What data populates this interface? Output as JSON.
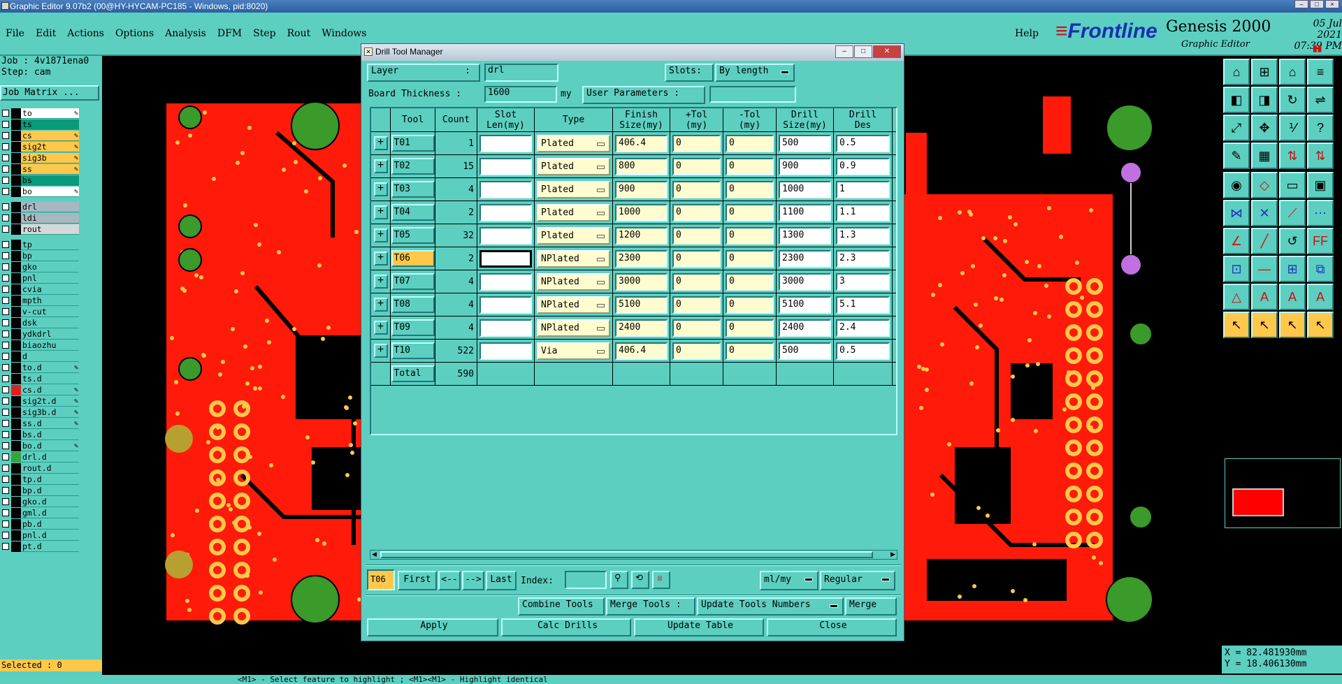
{
  "window": {
    "title": "Graphic Editor 9.07b2 (00@HY-HYCAM-PC185 - Windows, pid:8020)"
  },
  "menu": [
    "File",
    "Edit",
    "Actions",
    "Options",
    "Analysis",
    "DFM",
    "Step",
    "Rout",
    "Windows"
  ],
  "help_label": "Help",
  "brand": {
    "logo": "Frontline",
    "product": "Genesis 2000",
    "subtitle": "Graphic Editor",
    "date": "05 Jul 2021",
    "time": "07:39 PM"
  },
  "left": {
    "job": "Job : 4v1871ena0",
    "step": "Step: cam",
    "job_matrix": "Job Matrix ...",
    "layers": [
      {
        "name": "to",
        "bg": "#ffffff",
        "swatch": "#000000",
        "pen": true
      },
      {
        "name": "ts",
        "bg": "#0a9a7a",
        "swatch": "#000000",
        "pen": false
      },
      {
        "name": "cs",
        "bg": "#ffc84a",
        "swatch": "#000000",
        "pen": true
      },
      {
        "name": "sig2t",
        "bg": "#ffc84a",
        "swatch": "#000000",
        "pen": true
      },
      {
        "name": "sig3b",
        "bg": "#ffc84a",
        "swatch": "#000000",
        "pen": true
      },
      {
        "name": "ss",
        "bg": "#ffc84a",
        "swatch": "#000000",
        "pen": true
      },
      {
        "name": "bs",
        "bg": "#0a9a7a",
        "swatch": "#000000",
        "pen": false
      },
      {
        "name": "bo",
        "bg": "#ffffff",
        "swatch": "#000000",
        "pen": true
      },
      {
        "gap": true
      },
      {
        "name": "drl",
        "bg": "#a8b8c0",
        "swatch": "#000000",
        "pen": false
      },
      {
        "name": "ldi",
        "bg": "#a8b8c0",
        "swatch": "#000000",
        "pen": false
      },
      {
        "name": "rout",
        "bg": "#d8d8d8",
        "swatch": "#000000",
        "pen": false
      },
      {
        "gap": true
      },
      {
        "name": "tp",
        "bg": "#5ccfc1",
        "swatch": "#000000",
        "pen": false
      },
      {
        "name": "bp",
        "bg": "#5ccfc1",
        "swatch": "#000000",
        "pen": false
      },
      {
        "name": "gko",
        "bg": "#5ccfc1",
        "swatch": "#000000",
        "pen": false
      },
      {
        "name": "pnl",
        "bg": "#5ccfc1",
        "swatch": "#000000",
        "pen": false
      },
      {
        "name": "cvia",
        "bg": "#5ccfc1",
        "swatch": "#000000",
        "pen": false
      },
      {
        "name": "mpth",
        "bg": "#5ccfc1",
        "swatch": "#000000",
        "pen": false
      },
      {
        "name": "v-cut",
        "bg": "#5ccfc1",
        "swatch": "#000000",
        "pen": false
      },
      {
        "name": "dsk",
        "bg": "#5ccfc1",
        "swatch": "#000000",
        "pen": false
      },
      {
        "name": "ydkdrl",
        "bg": "#5ccfc1",
        "swatch": "#000000",
        "pen": false
      },
      {
        "name": "biaozhu",
        "bg": "#5ccfc1",
        "swatch": "#000000",
        "pen": false
      },
      {
        "name": "d",
        "bg": "#5ccfc1",
        "swatch": "#000000",
        "pen": false
      },
      {
        "name": "to.d",
        "bg": "#5ccfc1",
        "swatch": "#000000",
        "pen": true
      },
      {
        "name": "ts.d",
        "bg": "#5ccfc1",
        "swatch": "#000000",
        "pen": false
      },
      {
        "name": "cs.d",
        "bg": "#5ccfc1",
        "swatch": "#e02020",
        "pen": true
      },
      {
        "name": "sig2t.d",
        "bg": "#5ccfc1",
        "swatch": "#000000",
        "pen": true
      },
      {
        "name": "sig3b.d",
        "bg": "#5ccfc1",
        "swatch": "#000000",
        "pen": true
      },
      {
        "name": "ss.d",
        "bg": "#5ccfc1",
        "swatch": "#000000",
        "pen": true
      },
      {
        "name": "bs.d",
        "bg": "#5ccfc1",
        "swatch": "#000000",
        "pen": false
      },
      {
        "name": "bo.d",
        "bg": "#5ccfc1",
        "swatch": "#000000",
        "pen": true
      },
      {
        "name": "drl.d",
        "bg": "#5ccfc1",
        "swatch": "#3aa040",
        "pen": false
      },
      {
        "name": "rout.d",
        "bg": "#5ccfc1",
        "swatch": "#000000",
        "pen": false
      },
      {
        "name": "tp.d",
        "bg": "#5ccfc1",
        "swatch": "#000000",
        "pen": false
      },
      {
        "name": "bp.d",
        "bg": "#5ccfc1",
        "swatch": "#000000",
        "pen": false
      },
      {
        "name": "gko.d",
        "bg": "#5ccfc1",
        "swatch": "#000000",
        "pen": false
      },
      {
        "name": "gml.d",
        "bg": "#5ccfc1",
        "swatch": "#000000",
        "pen": false
      },
      {
        "name": "pb.d",
        "bg": "#5ccfc1",
        "swatch": "#000000",
        "pen": false
      },
      {
        "name": "pnl.d",
        "bg": "#5ccfc1",
        "swatch": "#000000",
        "pen": false
      },
      {
        "name": "pt.d",
        "bg": "#5ccfc1",
        "swatch": "#000000",
        "pen": false
      }
    ],
    "selected": "Selected : 0"
  },
  "dialog": {
    "title": "Drill Tool Manager",
    "layer_label": "Layer",
    "layer_sep": ":",
    "layer_value": "drl",
    "slots_label": "Slots:",
    "slots_value": "By length",
    "board_thickness_label": "Board Thickness :",
    "board_thickness_value": "1600",
    "board_thickness_unit": "my",
    "user_params_label": "User Parameters :",
    "user_params_value": "",
    "columns": [
      "Tool",
      "Count",
      "Slot\nLen(my)",
      "Type",
      "Finish\nSize(my)",
      "+Tol\n(my)",
      "-Tol\n(my)",
      "Drill\nSize(my)",
      "Drill\nDes"
    ],
    "rows": [
      {
        "tool": "T01",
        "count": "1",
        "slot": "",
        "type": "Plated",
        "finish": "406.4",
        "ptol": "0",
        "ntol": "0",
        "drill": "500",
        "des": "0.5"
      },
      {
        "tool": "T02",
        "count": "15",
        "slot": "",
        "type": "Plated",
        "finish": "800",
        "ptol": "0",
        "ntol": "0",
        "drill": "900",
        "des": "0.9"
      },
      {
        "tool": "T03",
        "count": "4",
        "slot": "",
        "type": "Plated",
        "finish": "900",
        "ptol": "0",
        "ntol": "0",
        "drill": "1000",
        "des": "1"
      },
      {
        "tool": "T04",
        "count": "2",
        "slot": "",
        "type": "Plated",
        "finish": "1000",
        "ptol": "0",
        "ntol": "0",
        "drill": "1100",
        "des": "1.1"
      },
      {
        "tool": "T05",
        "count": "32",
        "slot": "",
        "type": "Plated",
        "finish": "1200",
        "ptol": "0",
        "ntol": "0",
        "drill": "1300",
        "des": "1.3"
      },
      {
        "tool": "T06",
        "count": "2",
        "slot": "",
        "type": "NPlated",
        "finish": "2300",
        "ptol": "0",
        "ntol": "0",
        "drill": "2300",
        "des": "2.3",
        "selected": true
      },
      {
        "tool": "T07",
        "count": "4",
        "slot": "",
        "type": "NPlated",
        "finish": "3000",
        "ptol": "0",
        "ntol": "0",
        "drill": "3000",
        "des": "3"
      },
      {
        "tool": "T08",
        "count": "4",
        "slot": "",
        "type": "NPlated",
        "finish": "5100",
        "ptol": "0",
        "ntol": "0",
        "drill": "5100",
        "des": "5.1"
      },
      {
        "tool": "T09",
        "count": "4",
        "slot": "",
        "type": "NPlated",
        "finish": "2400",
        "ptol": "0",
        "ntol": "0",
        "drill": "2400",
        "des": "2.4"
      },
      {
        "tool": "T10",
        "count": "522",
        "slot": "",
        "type": "Via",
        "finish": "406.4",
        "ptol": "0",
        "ntol": "0",
        "drill": "500",
        "des": "0.5"
      }
    ],
    "total_label": "Total",
    "total_count": "590",
    "nav": {
      "current": "T06",
      "first": "First",
      "prev": "<--",
      "next": "-->",
      "last": "Last",
      "index_label": "Index:",
      "index_value": "",
      "units": "ml/my",
      "mode": "Regular"
    },
    "actions": {
      "combine": "Combine Tools",
      "merge_tools": "Merge Tools :",
      "update_numbers": "Update Tools Numbers",
      "merge": "Merge"
    },
    "bottom": {
      "apply": "Apply",
      "calc": "Calc Drills",
      "update": "Update Table",
      "close": "Close"
    }
  },
  "coords": {
    "x": "X = 82.481930mm",
    "y": "Y = 18.406130mm"
  },
  "status": {
    "message": "<M1> - Select feature to highlight ; <M1><M1> - Highlight identical"
  },
  "colors": {
    "teal": "#5ccfc1",
    "board_red": "#ff1a0a",
    "pad_green": "#3a9a2a",
    "highlight": "#ffc84a"
  }
}
